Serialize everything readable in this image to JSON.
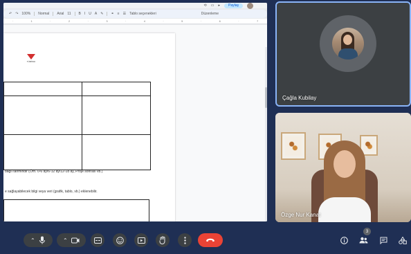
{
  "document": {
    "top": {
      "share_label": "Paylaş"
    },
    "toolbar": {
      "zoom": "100%",
      "style": "Normal",
      "font": "Arial",
      "size": "11",
      "table_options": "Tablo seçenekleri",
      "editing": "Düzenleme"
    },
    "logo_text": "TÜBİTAK",
    "text_line_1": "bağlı tahmindir (Örn. 0-6 ay/6-12 ay/12-18 ay, Proje sonrası vb.)",
    "text_line_2": "e sağlayabilecek bilgi veya veri (grafik, tablo, vb.) eklenebilir."
  },
  "participants": [
    {
      "name": "Çağla Kubilay"
    },
    {
      "name": "Özge Nur Kanat"
    }
  ],
  "controls": {
    "people_count": "3"
  },
  "colors": {
    "background": "#1f2f54",
    "tile": "#3c4043",
    "active_border": "#8ab4f8",
    "hangup": "#ea4335"
  },
  "icons": [
    "mic-icon",
    "camera-icon",
    "captions-icon",
    "emoji-icon",
    "present-icon",
    "hand-icon",
    "more-icon",
    "hangup-icon",
    "info-icon",
    "people-icon",
    "chat-icon",
    "activities-icon"
  ]
}
